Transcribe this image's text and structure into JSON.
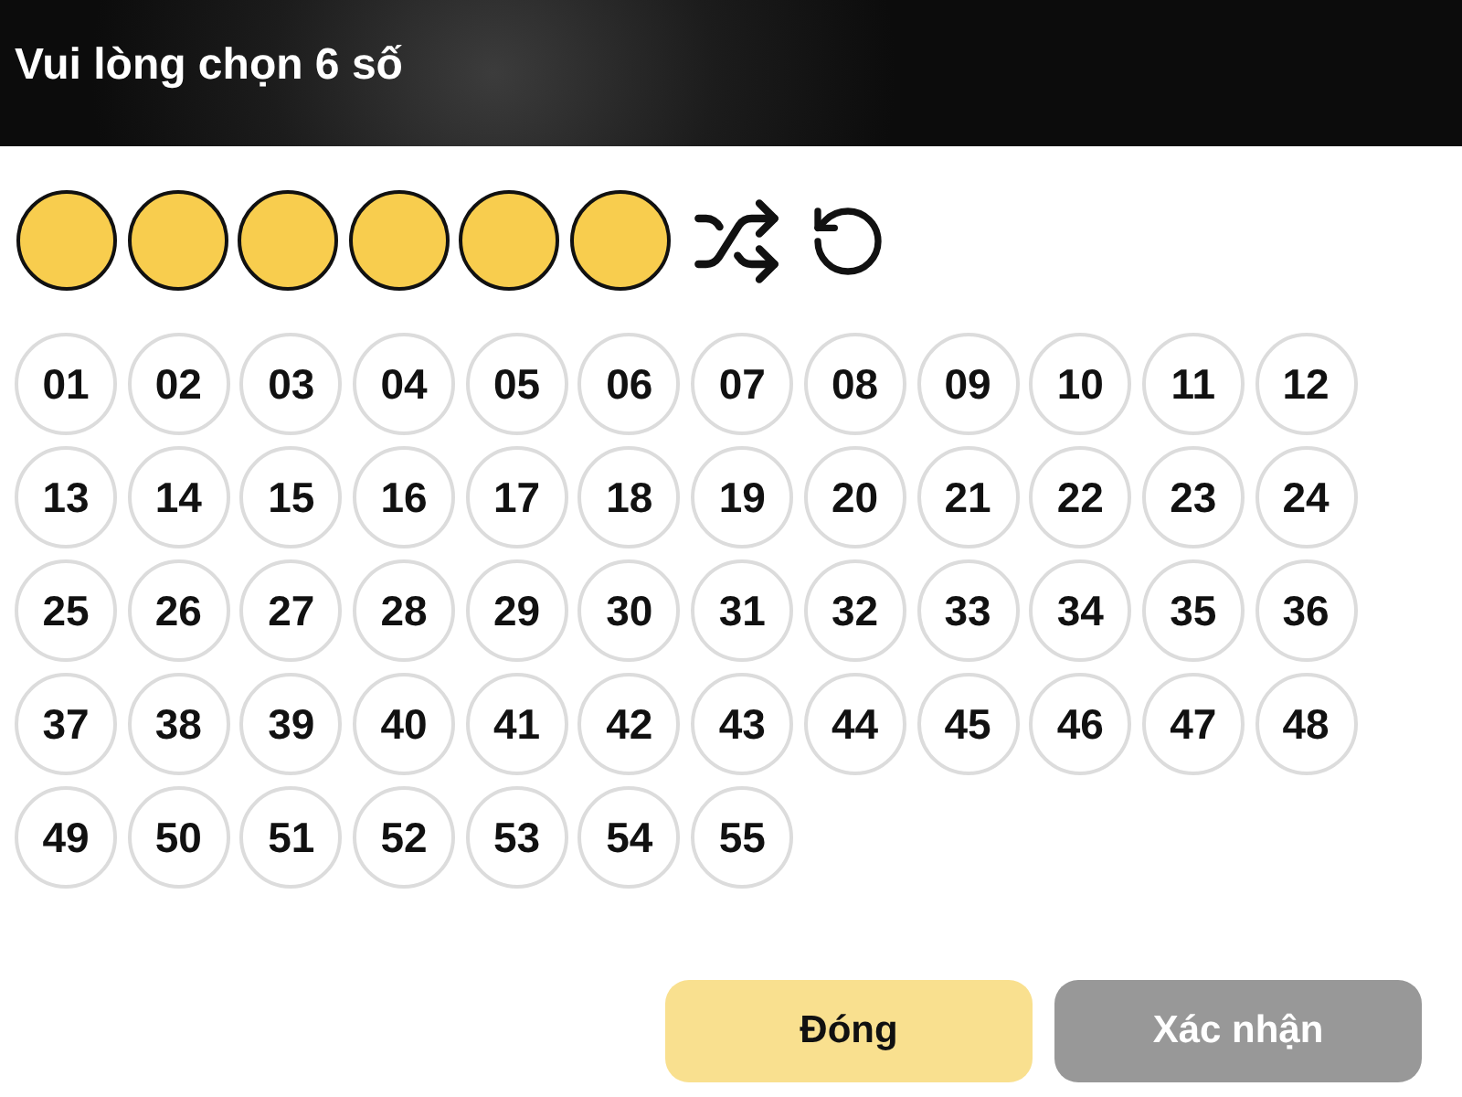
{
  "header": {
    "title": "Vui lòng chọn 6 số"
  },
  "slots": [
    {
      "filled": false
    },
    {
      "filled": false
    },
    {
      "filled": false
    },
    {
      "filled": false
    },
    {
      "filled": false
    },
    {
      "filled": false
    }
  ],
  "numbers": [
    {
      "label": "01",
      "selected": false
    },
    {
      "label": "02",
      "selected": false
    },
    {
      "label": "03",
      "selected": false
    },
    {
      "label": "04",
      "selected": false
    },
    {
      "label": "05",
      "selected": false
    },
    {
      "label": "06",
      "selected": false
    },
    {
      "label": "07",
      "selected": false
    },
    {
      "label": "08",
      "selected": false
    },
    {
      "label": "09",
      "selected": false
    },
    {
      "label": "10",
      "selected": false
    },
    {
      "label": "11",
      "selected": false
    },
    {
      "label": "12",
      "selected": false
    },
    {
      "label": "13",
      "selected": false
    },
    {
      "label": "14",
      "selected": false
    },
    {
      "label": "15",
      "selected": false
    },
    {
      "label": "16",
      "selected": false
    },
    {
      "label": "17",
      "selected": false
    },
    {
      "label": "18",
      "selected": false
    },
    {
      "label": "19",
      "selected": false
    },
    {
      "label": "20",
      "selected": false
    },
    {
      "label": "21",
      "selected": false
    },
    {
      "label": "22",
      "selected": false
    },
    {
      "label": "23",
      "selected": false
    },
    {
      "label": "24",
      "selected": false
    },
    {
      "label": "25",
      "selected": false
    },
    {
      "label": "26",
      "selected": false
    },
    {
      "label": "27",
      "selected": false
    },
    {
      "label": "28",
      "selected": false
    },
    {
      "label": "29",
      "selected": false
    },
    {
      "label": "30",
      "selected": false
    },
    {
      "label": "31",
      "selected": false
    },
    {
      "label": "32",
      "selected": false
    },
    {
      "label": "33",
      "selected": false
    },
    {
      "label": "34",
      "selected": false
    },
    {
      "label": "35",
      "selected": false
    },
    {
      "label": "36",
      "selected": false
    },
    {
      "label": "37",
      "selected": false
    },
    {
      "label": "38",
      "selected": false
    },
    {
      "label": "39",
      "selected": false
    },
    {
      "label": "40",
      "selected": false
    },
    {
      "label": "41",
      "selected": false
    },
    {
      "label": "42",
      "selected": false
    },
    {
      "label": "43",
      "selected": false
    },
    {
      "label": "44",
      "selected": false
    },
    {
      "label": "45",
      "selected": false
    },
    {
      "label": "46",
      "selected": false
    },
    {
      "label": "47",
      "selected": false
    },
    {
      "label": "48",
      "selected": false
    },
    {
      "label": "49",
      "selected": false
    },
    {
      "label": "50",
      "selected": false
    },
    {
      "label": "51",
      "selected": false
    },
    {
      "label": "52",
      "selected": false
    },
    {
      "label": "53",
      "selected": false
    },
    {
      "label": "54",
      "selected": false
    },
    {
      "label": "55",
      "selected": false
    }
  ],
  "buttons": [
    {
      "kind": "close",
      "label": "Đóng",
      "disabled": false
    },
    {
      "kind": "confirm",
      "label": "Xác nhận",
      "disabled": true
    }
  ]
}
